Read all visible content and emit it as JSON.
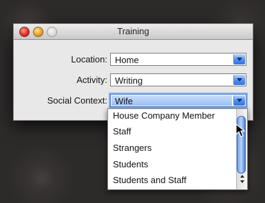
{
  "window": {
    "title": "Training"
  },
  "form": {
    "location_label": "Location:",
    "location_value": "Home",
    "activity_label": "Activity:",
    "activity_value": "Writing",
    "social_label": "Social Context:",
    "social_value": "Wife"
  },
  "dropdown": {
    "items": [
      "House Company Member",
      "Staff",
      "Strangers",
      "Students",
      "Students and Staff"
    ]
  }
}
